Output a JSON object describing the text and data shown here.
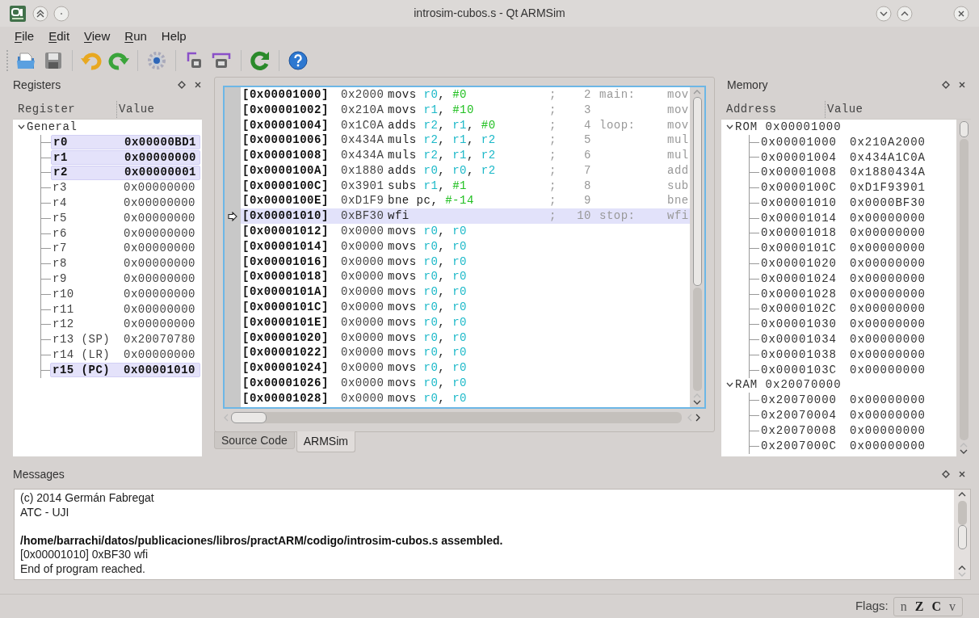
{
  "window": {
    "title": "introsim-cubos.s - Qt ARMSim"
  },
  "menu": [
    {
      "label": "File",
      "underline": true
    },
    {
      "label": "Edit",
      "underline": true
    },
    {
      "label": "View",
      "underline": true
    },
    {
      "label": "Run",
      "underline": true
    },
    {
      "label": "Help",
      "underline": false
    }
  ],
  "registers": {
    "title": "Registers",
    "columns": [
      "Register",
      "Value"
    ],
    "group": {
      "label": "General",
      "expanded": true,
      "children": [
        {
          "name": "r0",
          "value": "0x00000BD1",
          "changed": true
        },
        {
          "name": "r1",
          "value": "0x00000000",
          "changed": true
        },
        {
          "name": "r2",
          "value": "0x00000001",
          "changed": true
        },
        {
          "name": "r3",
          "value": "0x00000000",
          "changed": false
        },
        {
          "name": "r4",
          "value": "0x00000000",
          "changed": false
        },
        {
          "name": "r5",
          "value": "0x00000000",
          "changed": false
        },
        {
          "name": "r6",
          "value": "0x00000000",
          "changed": false
        },
        {
          "name": "r7",
          "value": "0x00000000",
          "changed": false
        },
        {
          "name": "r8",
          "value": "0x00000000",
          "changed": false
        },
        {
          "name": "r9",
          "value": "0x00000000",
          "changed": false
        },
        {
          "name": "r10",
          "value": "0x00000000",
          "changed": false
        },
        {
          "name": "r11",
          "value": "0x00000000",
          "changed": false
        },
        {
          "name": "r12",
          "value": "0x00000000",
          "changed": false
        },
        {
          "name": "r13 (SP)",
          "value": "0x20070780",
          "changed": false
        },
        {
          "name": "r14 (LR)",
          "value": "0x00000000",
          "changed": false
        },
        {
          "name": "r15 (PC)",
          "value": "0x00001010",
          "changed": true
        }
      ]
    }
  },
  "code": {
    "rows": [
      {
        "address": "[0x00001000]",
        "opcode": "0x2000",
        "mnemonic": "movs",
        "operands": [
          {
            "t": "r0",
            "kind": "reg"
          },
          {
            "t": ", ",
            "kind": "plain"
          },
          {
            "t": "#0",
            "kind": "imm"
          }
        ],
        "comment": ";",
        "line": "2",
        "label": "main:",
        "source": "mov",
        "current": false
      },
      {
        "address": "[0x00001002]",
        "opcode": "0x210A",
        "mnemonic": "movs",
        "operands": [
          {
            "t": "r1",
            "kind": "reg"
          },
          {
            "t": ", ",
            "kind": "plain"
          },
          {
            "t": "#10",
            "kind": "imm"
          }
        ],
        "comment": ";",
        "line": "3",
        "source": "mov",
        "current": false
      },
      {
        "address": "[0x00001004]",
        "opcode": "0x1C0A",
        "mnemonic": "adds",
        "operands": [
          {
            "t": "r2",
            "kind": "reg"
          },
          {
            "t": ", ",
            "kind": "plain"
          },
          {
            "t": "r1",
            "kind": "reg"
          },
          {
            "t": ", ",
            "kind": "plain"
          },
          {
            "t": "#0",
            "kind": "imm"
          }
        ],
        "comment": ";",
        "line": "4",
        "label": "loop:",
        "source": "mov",
        "current": false
      },
      {
        "address": "[0x00001006]",
        "opcode": "0x434A",
        "mnemonic": "muls",
        "operands": [
          {
            "t": "r2",
            "kind": "reg"
          },
          {
            "t": ", ",
            "kind": "plain"
          },
          {
            "t": "r1",
            "kind": "reg"
          },
          {
            "t": ", ",
            "kind": "plain"
          },
          {
            "t": "r2",
            "kind": "reg"
          }
        ],
        "comment": ";",
        "line": "5",
        "source": "mul",
        "current": false
      },
      {
        "address": "[0x00001008]",
        "opcode": "0x434A",
        "mnemonic": "muls",
        "operands": [
          {
            "t": "r2",
            "kind": "reg"
          },
          {
            "t": ", ",
            "kind": "plain"
          },
          {
            "t": "r1",
            "kind": "reg"
          },
          {
            "t": ", ",
            "kind": "plain"
          },
          {
            "t": "r2",
            "kind": "reg"
          }
        ],
        "comment": ";",
        "line": "6",
        "source": "mul",
        "current": false
      },
      {
        "address": "[0x0000100A]",
        "opcode": "0x1880",
        "mnemonic": "adds",
        "operands": [
          {
            "t": "r0",
            "kind": "reg"
          },
          {
            "t": ", ",
            "kind": "plain"
          },
          {
            "t": "r0",
            "kind": "reg"
          },
          {
            "t": ", ",
            "kind": "plain"
          },
          {
            "t": "r2",
            "kind": "reg"
          }
        ],
        "comment": ";",
        "line": "7",
        "source": "add",
        "current": false
      },
      {
        "address": "[0x0000100C]",
        "opcode": "0x3901",
        "mnemonic": "subs",
        "operands": [
          {
            "t": "r1",
            "kind": "reg"
          },
          {
            "t": ", ",
            "kind": "plain"
          },
          {
            "t": "#1",
            "kind": "imm"
          }
        ],
        "comment": ";",
        "line": "8",
        "source": "sub",
        "current": false
      },
      {
        "address": "[0x0000100E]",
        "opcode": "0xD1F9",
        "mnemonic": "bne",
        "operands": [
          {
            "t": "pc, ",
            "kind": "plain"
          },
          {
            "t": "#-14",
            "kind": "imm"
          }
        ],
        "comment": ";",
        "line": "9",
        "source": "bne",
        "current": false
      },
      {
        "address": "[0x00001010]",
        "opcode": "0xBF30",
        "mnemonic": "wfi",
        "operands": [],
        "comment": ";",
        "line": "10",
        "label": "stop:",
        "source": "wfi",
        "current": true
      },
      {
        "address": "[0x00001012]",
        "opcode": "0x0000",
        "mnemonic": "movs",
        "operands": [
          {
            "t": "r0",
            "kind": "reg"
          },
          {
            "t": ", ",
            "kind": "plain"
          },
          {
            "t": "r0",
            "kind": "reg"
          }
        ],
        "current": false
      },
      {
        "address": "[0x00001014]",
        "opcode": "0x0000",
        "mnemonic": "movs",
        "operands": [
          {
            "t": "r0",
            "kind": "reg"
          },
          {
            "t": ", ",
            "kind": "plain"
          },
          {
            "t": "r0",
            "kind": "reg"
          }
        ],
        "current": false
      },
      {
        "address": "[0x00001016]",
        "opcode": "0x0000",
        "mnemonic": "movs",
        "operands": [
          {
            "t": "r0",
            "kind": "reg"
          },
          {
            "t": ", ",
            "kind": "plain"
          },
          {
            "t": "r0",
            "kind": "reg"
          }
        ],
        "current": false
      },
      {
        "address": "[0x00001018]",
        "opcode": "0x0000",
        "mnemonic": "movs",
        "operands": [
          {
            "t": "r0",
            "kind": "reg"
          },
          {
            "t": ", ",
            "kind": "plain"
          },
          {
            "t": "r0",
            "kind": "reg"
          }
        ],
        "current": false
      },
      {
        "address": "[0x0000101A]",
        "opcode": "0x0000",
        "mnemonic": "movs",
        "operands": [
          {
            "t": "r0",
            "kind": "reg"
          },
          {
            "t": ", ",
            "kind": "plain"
          },
          {
            "t": "r0",
            "kind": "reg"
          }
        ],
        "current": false
      },
      {
        "address": "[0x0000101C]",
        "opcode": "0x0000",
        "mnemonic": "movs",
        "operands": [
          {
            "t": "r0",
            "kind": "reg"
          },
          {
            "t": ", ",
            "kind": "plain"
          },
          {
            "t": "r0",
            "kind": "reg"
          }
        ],
        "current": false
      },
      {
        "address": "[0x0000101E]",
        "opcode": "0x0000",
        "mnemonic": "movs",
        "operands": [
          {
            "t": "r0",
            "kind": "reg"
          },
          {
            "t": ", ",
            "kind": "plain"
          },
          {
            "t": "r0",
            "kind": "reg"
          }
        ],
        "current": false
      },
      {
        "address": "[0x00001020]",
        "opcode": "0x0000",
        "mnemonic": "movs",
        "operands": [
          {
            "t": "r0",
            "kind": "reg"
          },
          {
            "t": ", ",
            "kind": "plain"
          },
          {
            "t": "r0",
            "kind": "reg"
          }
        ],
        "current": false
      },
      {
        "address": "[0x00001022]",
        "opcode": "0x0000",
        "mnemonic": "movs",
        "operands": [
          {
            "t": "r0",
            "kind": "reg"
          },
          {
            "t": ", ",
            "kind": "plain"
          },
          {
            "t": "r0",
            "kind": "reg"
          }
        ],
        "current": false
      },
      {
        "address": "[0x00001024]",
        "opcode": "0x0000",
        "mnemonic": "movs",
        "operands": [
          {
            "t": "r0",
            "kind": "reg"
          },
          {
            "t": ", ",
            "kind": "plain"
          },
          {
            "t": "r0",
            "kind": "reg"
          }
        ],
        "current": false
      },
      {
        "address": "[0x00001026]",
        "opcode": "0x0000",
        "mnemonic": "movs",
        "operands": [
          {
            "t": "r0",
            "kind": "reg"
          },
          {
            "t": ", ",
            "kind": "plain"
          },
          {
            "t": "r0",
            "kind": "reg"
          }
        ],
        "current": false
      },
      {
        "address": "[0x00001028]",
        "opcode": "0x0000",
        "mnemonic": "movs",
        "operands": [
          {
            "t": "r0",
            "kind": "reg"
          },
          {
            "t": ", ",
            "kind": "plain"
          },
          {
            "t": "r0",
            "kind": "reg"
          }
        ],
        "current": false
      }
    ],
    "tabs": [
      {
        "label": "Source Code",
        "selected": false
      },
      {
        "label": "ARMSim",
        "selected": true
      }
    ]
  },
  "memory": {
    "title": "Memory",
    "columns": [
      "Address",
      "Value"
    ],
    "groups": [
      {
        "label": "ROM 0x00001000",
        "expanded": true,
        "children": [
          {
            "address": "0x00001000",
            "value": "0x210A2000"
          },
          {
            "address": "0x00001004",
            "value": "0x434A1C0A"
          },
          {
            "address": "0x00001008",
            "value": "0x1880434A"
          },
          {
            "address": "0x0000100C",
            "value": "0xD1F93901"
          },
          {
            "address": "0x00001010",
            "value": "0x0000BF30"
          },
          {
            "address": "0x00001014",
            "value": "0x00000000"
          },
          {
            "address": "0x00001018",
            "value": "0x00000000"
          },
          {
            "address": "0x0000101C",
            "value": "0x00000000"
          },
          {
            "address": "0x00001020",
            "value": "0x00000000"
          },
          {
            "address": "0x00001024",
            "value": "0x00000000"
          },
          {
            "address": "0x00001028",
            "value": "0x00000000"
          },
          {
            "address": "0x0000102C",
            "value": "0x00000000"
          },
          {
            "address": "0x00001030",
            "value": "0x00000000"
          },
          {
            "address": "0x00001034",
            "value": "0x00000000"
          },
          {
            "address": "0x00001038",
            "value": "0x00000000"
          },
          {
            "address": "0x0000103C",
            "value": "0x00000000"
          }
        ]
      },
      {
        "label": "RAM 0x20070000",
        "expanded": true,
        "children": [
          {
            "address": "0x20070000",
            "value": "0x00000000"
          },
          {
            "address": "0x20070004",
            "value": "0x00000000"
          },
          {
            "address": "0x20070008",
            "value": "0x00000000"
          },
          {
            "address": "0x2007000C",
            "value": "0x00000000"
          }
        ]
      }
    ]
  },
  "messages": {
    "title": "Messages",
    "lines": [
      {
        "text": "(c) 2014 Germán Fabregat",
        "kind": "plain"
      },
      {
        "text": "ATC - UJI",
        "kind": "plain"
      },
      {
        "text": "/home/barrachi/datos/publicaciones/libros/practARM/codigo/introsim-cubos.s assembled.",
        "kind": "strong"
      },
      {
        "text": "[0x00001010] 0xBF30 wfi",
        "kind": "plain"
      },
      {
        "text": "End of program reached.",
        "kind": "plain"
      }
    ]
  },
  "status_bar": {
    "label": "Flags:",
    "flags": [
      {
        "label": "n",
        "set": false
      },
      {
        "label": "Z",
        "set": true
      },
      {
        "label": "C",
        "set": true
      },
      {
        "label": "v",
        "set": false
      }
    ]
  }
}
